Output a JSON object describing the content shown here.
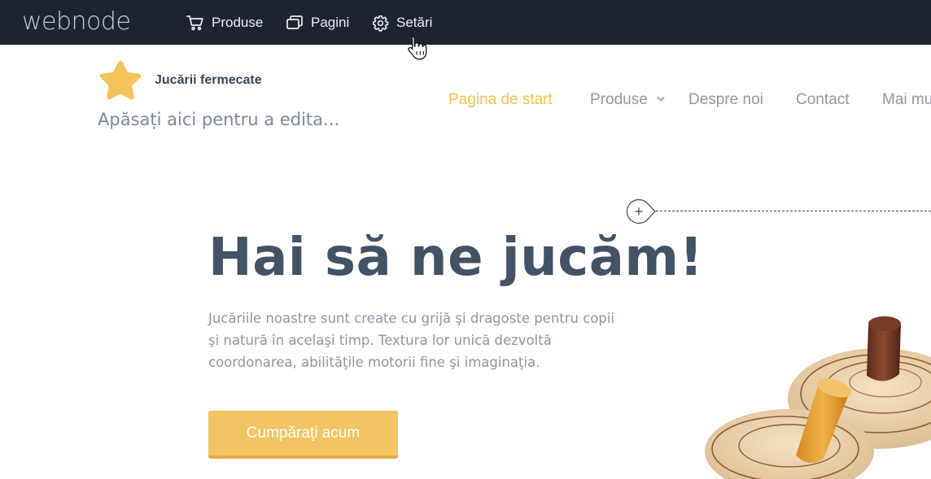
{
  "editor": {
    "brand": "webnode",
    "menu": [
      {
        "label": "Produse",
        "icon": "cart-icon"
      },
      {
        "label": "Pagini",
        "icon": "pages-icon"
      },
      {
        "label": "Setări",
        "icon": "gear-icon"
      }
    ]
  },
  "site": {
    "name": "Jucării fermecate",
    "tagline": "Apăsați aici pentru a edita...",
    "logo_icon": "star-icon",
    "nav": [
      {
        "label": "Pagina de start",
        "active": true
      },
      {
        "label": "Produse",
        "has_dropdown": true
      },
      {
        "label": "Despre noi"
      },
      {
        "label": "Contact"
      },
      {
        "label": "Mai mu"
      }
    ]
  },
  "hero": {
    "title": "Hai să ne jucăm!",
    "text_lines": [
      "Jucăriile noastre sunt create cu grijă şi dragoste pentru copii",
      "şi natură în acelaşi timp. Textura lor unică dezvoltă",
      "coordonarea, abilităţile motorii fine şi imaginaţia."
    ],
    "button_label": "Cumpăraţi acum"
  },
  "colors": {
    "topbar_bg": "#1e2330",
    "accent": "#f2c048",
    "button": "#f2c463",
    "heading": "#435265",
    "muted_text": "#8d97a3"
  }
}
